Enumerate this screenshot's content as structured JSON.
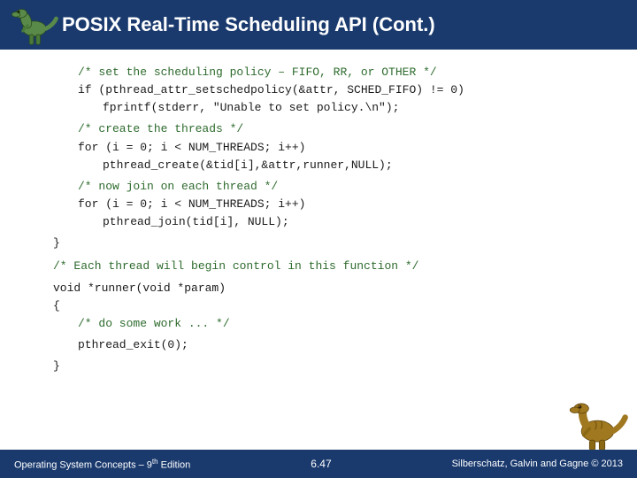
{
  "header": {
    "title": "POSIX Real-Time Scheduling API (Cont.)"
  },
  "code": {
    "lines": [
      {
        "indent": 1,
        "type": "comment",
        "text": "/* set the scheduling policy – FIFO, RR, or OTHER */"
      },
      {
        "indent": 1,
        "type": "code",
        "text": "if (pthread_attr_setschedpolicy(&attr, SCHED_FIFO) != 0)"
      },
      {
        "indent": 2,
        "type": "code",
        "text": "fprintf(stderr, \"Unable to set policy.\\n\");"
      },
      {
        "indent": 0,
        "type": "blank",
        "text": ""
      },
      {
        "indent": 1,
        "type": "comment",
        "text": "/* create the threads */"
      },
      {
        "indent": 1,
        "type": "code",
        "text": "for (i = 0; i < NUM_THREADS; i++)"
      },
      {
        "indent": 2,
        "type": "code",
        "text": "pthread_create(&tid[i],&attr,runner,NULL);"
      },
      {
        "indent": 0,
        "type": "blank",
        "text": ""
      },
      {
        "indent": 1,
        "type": "comment",
        "text": "/* now join on each thread */"
      },
      {
        "indent": 1,
        "type": "code",
        "text": "for (i = 0; i < NUM_THREADS; i++)"
      },
      {
        "indent": 2,
        "type": "code",
        "text": "pthread_join(tid[i], NULL);"
      },
      {
        "indent": 0,
        "type": "blank",
        "text": ""
      },
      {
        "indent": 0,
        "type": "code",
        "text": "}"
      },
      {
        "indent": 0,
        "type": "blank",
        "text": ""
      },
      {
        "indent": 0,
        "type": "comment",
        "text": "/* Each thread will begin control in this function */"
      },
      {
        "indent": 0,
        "type": "blank",
        "text": ""
      },
      {
        "indent": 0,
        "type": "code",
        "text": "void *runner(void *param)"
      },
      {
        "indent": 0,
        "type": "code",
        "text": "{"
      },
      {
        "indent": 1,
        "type": "comment",
        "text": "/* do some work ... */"
      },
      {
        "indent": 0,
        "type": "blank",
        "text": ""
      },
      {
        "indent": 1,
        "type": "code",
        "text": "pthread_exit(0);"
      },
      {
        "indent": 0,
        "type": "blank",
        "text": ""
      },
      {
        "indent": 0,
        "type": "code",
        "text": "}"
      }
    ]
  },
  "footer": {
    "left": "Operating System Concepts – 9th Edition",
    "center": "6.47",
    "right": "Silberschatz, Galvin and Gagne © 2013"
  }
}
